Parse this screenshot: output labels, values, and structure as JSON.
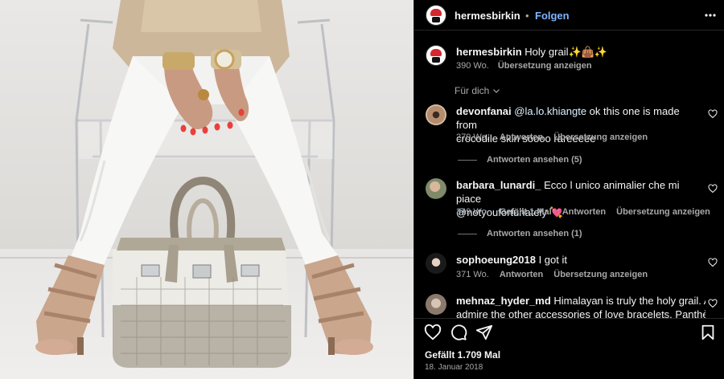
{
  "post": {
    "username": "hermesbirkin",
    "separator": "•",
    "follow_label": "Folgen",
    "more_icon": "more-horizontal-icon"
  },
  "caption": {
    "username": "hermesbirkin",
    "text": "Holy grail✨👜✨",
    "time": "390 Wo.",
    "translate": "Übersetzung anzeigen"
  },
  "for_you_label": "Für dich",
  "comments": [
    {
      "username": "devonfanai",
      "mention": "@la.lo.khiangte",
      "text_line1": " ok this one is made from",
      "text_line2": "crocodile skin soooo rareeeee",
      "time": "279 Wo.",
      "reply": "Antworten",
      "translate": "Übersetzung anzeigen",
      "view_replies": "Antworten ansehen (5)"
    },
    {
      "username": "barbara_lunardi_",
      "text_line1": " Ecco l unico animalier che mi piace",
      "mention": "@notyoufortunately",
      "emoji": "💘",
      "time": "349 Wo.",
      "likes": "Gefällt 1 Mal",
      "reply": "Antworten",
      "translate": "Übersetzung anzeigen",
      "view_replies": "Antworten ansehen (1)"
    },
    {
      "username": "sophoeung2018",
      "text_line1": " I got it",
      "time": "371 Wo.",
      "reply": "Antworten",
      "translate": "Übersetzung anzeigen"
    },
    {
      "username": "mehnaz_hyder_md",
      "text_line1": " Himalayan is truly the holy grail. Also",
      "text_line2": "admire the other accessories of love bracelets, Panthère de"
    }
  ],
  "footer": {
    "likes": "Gefällt 1.709 Mal",
    "date": "18. Januar 2018"
  },
  "colors": {
    "background": "#000000",
    "text": "#f5f5f5",
    "secondary": "#a8a8a8",
    "follow_blue": "#7db5ff",
    "divider": "#262626"
  }
}
